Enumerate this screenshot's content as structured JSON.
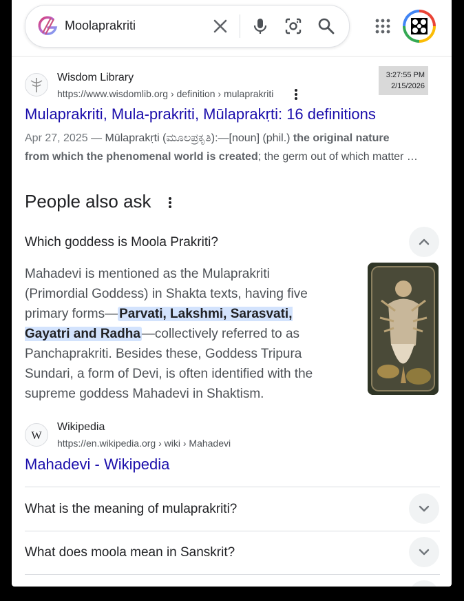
{
  "search": {
    "query": "Moolaprakriti"
  },
  "result1": {
    "site_name": "Wisdom Library",
    "url": "https://www.wisdomlib.org › definition › mulaprakriti",
    "title": "Mulaprakriti, Mula-prakriti, Mūlaprakṛti: 16 definitions",
    "date": "Apr 27, 2025",
    "snippet_pre": " — Mūlaprakṛti (ಮೂಲಪ್ರಕೃತಿ):—[noun] (phil.) ",
    "snippet_bold1": "the original nature",
    "snippet_bold2": "from which the phenomenal world is created",
    "snippet_post": "; the germ out of which matter …"
  },
  "timestamp": {
    "time": "3:27:55 PM",
    "date": "2/15/2026"
  },
  "paa": {
    "title": "People also ask",
    "q1": "Which goddess is Moola Prakriti?",
    "answer_pre": "Mahadevi is mentioned as the Mulaprakriti (Primordial Goddess) in Shakta texts, having five primary forms—",
    "answer_hl": "Parvati, Lakshmi, Sarasvati, Gayatri and Radha",
    "answer_post": "—collectively referred to as Panchaprakriti. Besides these, Goddess Tripura Sundari, a form of Devi, is often identified with the supreme goddess Mahadevi in Shaktism.",
    "source_name": "Wikipedia",
    "source_url": "https://en.wikipedia.org › wiki › Mahadevi",
    "source_title": "Mahadevi - Wikipedia",
    "q2": "What is the meaning of mulaprakriti?",
    "q3": "What does moola mean in Sanskrit?"
  },
  "colors": {
    "link": "#1a0dab",
    "text": "#202124",
    "muted": "#4d5156",
    "highlight": "#d3e3fd"
  }
}
